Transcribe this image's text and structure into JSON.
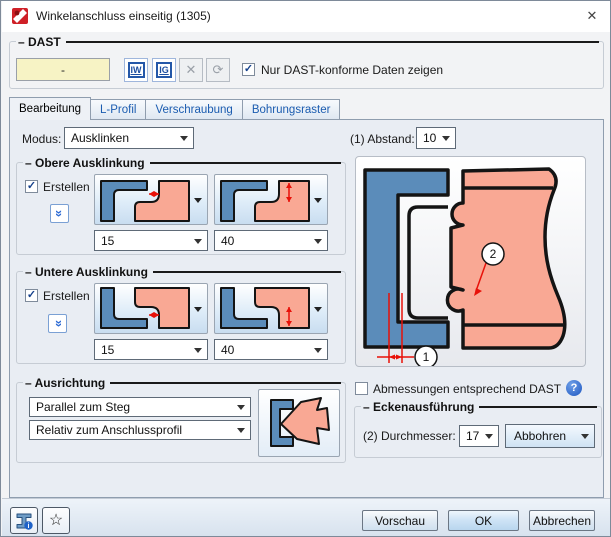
{
  "window": {
    "title": "Winkelanschluss einseitig (1305)",
    "close_glyph": "✕"
  },
  "dast": {
    "title": "DAST",
    "field_value": "-",
    "iw_label": "IW",
    "ig_label": "IG",
    "delete_glyph": "✕",
    "refresh_glyph": "⟳",
    "checkbox_label": "Nur DAST-konforme Daten zeigen",
    "check_glyph": "✓"
  },
  "tabs": {
    "t0": "Bearbeitung",
    "t1": "L-Profil",
    "t2": "Verschraubung",
    "t3": "Bohrungsraster"
  },
  "modus": {
    "label": "Modus:",
    "value": "Ausklinken"
  },
  "abstand": {
    "label": "(1) Abstand:",
    "value": "10"
  },
  "obere": {
    "title": "Obere Ausklinkung",
    "erstellen_label": "Erstellen",
    "check_glyph": "✓",
    "chevron_glyph": "»",
    "tiefe_value": "15",
    "laenge_value": "40"
  },
  "untere": {
    "title": "Untere Ausklinkung",
    "erstellen_label": "Erstellen",
    "check_glyph": "✓",
    "chevron_glyph": "«",
    "tiefe_value": "15",
    "laenge_value": "40"
  },
  "ausrichtung": {
    "title": "Ausrichtung",
    "option1": "Parallel zum Steg",
    "option2": "Relativ zum Anschlussprofil"
  },
  "preview": {
    "callout1": "1",
    "callout2": "2"
  },
  "dast_dims": {
    "label": "Abmessungen entsprechend DAST",
    "help_glyph": "?"
  },
  "ecken": {
    "title": "Eckenausführung",
    "durchmesser_label": "(2) Durchmesser:",
    "durchmesser_value": "17",
    "mode_value": "Abbohren"
  },
  "footer": {
    "star_glyph": "☆",
    "vorschau": "Vorschau",
    "ok": "OK",
    "abbrechen": "Abbrechen"
  },
  "colors": {
    "steel_blue": "#5b8cba",
    "salmon": "#f9a894",
    "dimension_red": "#e81109",
    "accent_blue": "#2e6bd4",
    "field_yellow": "#f7f3c5"
  }
}
